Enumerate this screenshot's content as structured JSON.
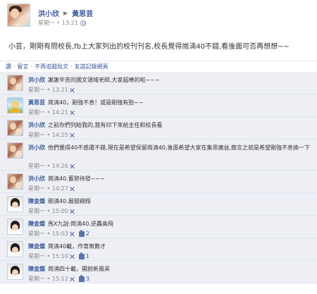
{
  "post": {
    "author": "洪小欣",
    "recipient": "黃思芸",
    "time": "星期一 • 13:21",
    "text": "小芸，剛剛有問校長,fb上大家列出的校刊刊名,校長覺得崗湳40不錯,看後面可否再想想~~"
  },
  "actions": {
    "like": "讚",
    "comment": "留言",
    "unfollow": "不再追蹤貼文",
    "share": "友誼記錄網頁",
    "separator": "·"
  },
  "comments": [
    {
      "author": "洪小欣",
      "text": "謝謝辛苦的國文領域老師,大家超棒的啦~~~",
      "time": "星期一 • 13:21",
      "likes": ""
    },
    {
      "author": "黃思芸",
      "text": "崗湳40，剛強不息！或是剛強有勁~~",
      "time": "星期一 • 14:21",
      "likes": ""
    },
    {
      "author": "洪小欣",
      "text": "之前你們列給我的,我有印下來給主任和校長看",
      "time": "星期一 • 14:25",
      "likes": ""
    },
    {
      "author": "洪小欣",
      "text": "他們覺得40不惑還不錯,現在是希望保留崗湳40,後面希望大家在集思廣益,簡言之就是希望剛強不息換一下",
      "time": "星期一 • 14:26",
      "likes": ""
    },
    {
      "author": "洪小欣",
      "text": "崗湳40.蓄勢待發~~~",
      "time": "星期一 • 14:27",
      "likes": ""
    },
    {
      "author": "陳金燦",
      "text": "剛湳40.展翅翱翔",
      "time": "星期一 • 15:00",
      "likes": ""
    },
    {
      "author": "陳金燦",
      "text": "馬X九說:崗湳40.逆轟高飛",
      "time": "星期一 • 15:03",
      "likes": "2"
    },
    {
      "author": "陳金燦",
      "text": "崗湳40載，作育無數才",
      "time": "星期一 • 15:10",
      "likes": "1"
    },
    {
      "author": "陳金燦",
      "text": "崗湳四十載，開創新風采",
      "time": "星期一 • 15:12",
      "likes": "3"
    }
  ]
}
